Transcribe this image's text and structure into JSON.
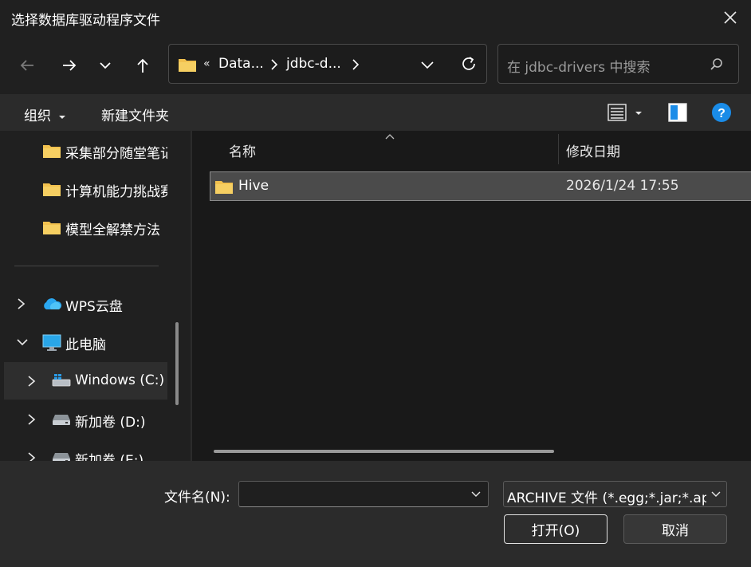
{
  "window": {
    "title": "选择数据库驱动程序文件"
  },
  "navigation": {
    "address_crumbs": [
      "Data...",
      "jdbc-d..."
    ],
    "overflow_marker": "«",
    "search_placeholder": "在 jdbc-drivers 中搜索"
  },
  "toolbar": {
    "organize_label": "组织",
    "new_folder_label": "新建文件夹"
  },
  "sidebar": {
    "folders": [
      "采集部分随堂笔记",
      "计算机能力挑战赛",
      "模型全解禁方法"
    ],
    "wps_cloud": "WPS云盘",
    "this_pc": "此电脑",
    "drives": [
      {
        "label": "Windows  (C:)"
      },
      {
        "label": "新加卷 (D:)"
      },
      {
        "label": "新加卷 (E:)"
      }
    ]
  },
  "file_list": {
    "columns": [
      "名称",
      "修改日期"
    ],
    "rows": [
      {
        "name": "Hive",
        "modified": "2026/1/24 17:55"
      }
    ]
  },
  "footer": {
    "filename_label": "文件名(N):",
    "filename_value": "",
    "filetype_value": "ARCHIVE 文件 (*.egg;*.jar;*.ap",
    "open_label": "打开(O)",
    "cancel_label": "取消"
  },
  "colors": {
    "folder": "#f2c14e",
    "help_accent": "#1a8ce8",
    "background": "#202020"
  }
}
